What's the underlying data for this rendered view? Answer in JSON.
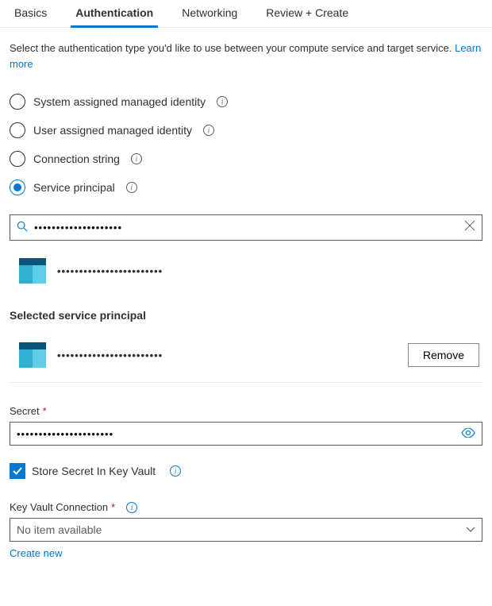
{
  "tabs": {
    "items": [
      {
        "label": "Basics",
        "active": false
      },
      {
        "label": "Authentication",
        "active": true
      },
      {
        "label": "Networking",
        "active": false
      },
      {
        "label": "Review + Create",
        "active": false
      }
    ]
  },
  "intro": {
    "text": "Select the authentication type you'd like to use between your compute service and target service. ",
    "learn_more": "Learn more"
  },
  "auth_options": [
    {
      "label": "System assigned managed identity",
      "selected": false
    },
    {
      "label": "User assigned managed identity",
      "selected": false
    },
    {
      "label": "Connection string",
      "selected": false
    },
    {
      "label": "Service principal",
      "selected": true
    }
  ],
  "search": {
    "value": "••••••••••••••••••••"
  },
  "search_result": {
    "masked": "••••••••••••••••••••••••"
  },
  "selected_section_title": "Selected service principal",
  "selected_principal": {
    "masked": "••••••••••••••••••••••••",
    "remove_label": "Remove"
  },
  "secret": {
    "label": "Secret",
    "value": "••••••••••••••••••••••"
  },
  "store_kv": {
    "label": "Store Secret In Key Vault",
    "checked": true
  },
  "kv_conn": {
    "label": "Key Vault Connection",
    "selected": "No item available",
    "create_new": "Create new"
  }
}
